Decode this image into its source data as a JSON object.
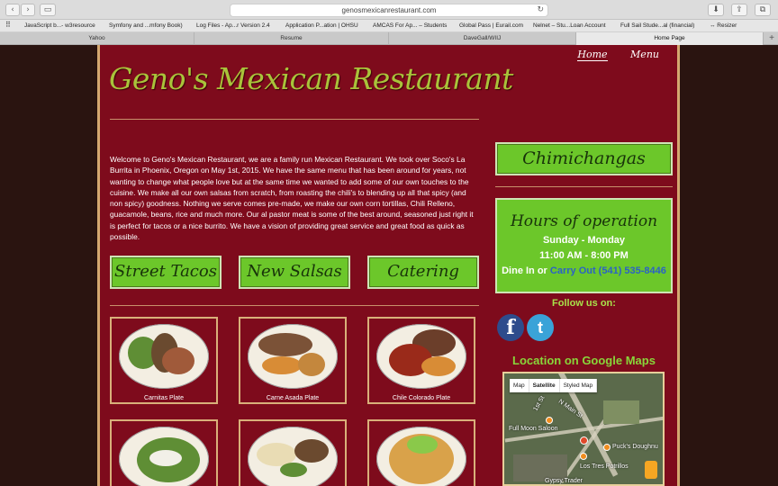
{
  "browser": {
    "back_glyph": "‹",
    "forward_glyph": "›",
    "sidebar_icon": "sidebar-icon",
    "url": "genosmexicanrestaurant.com",
    "reload_glyph": "↻",
    "download_glyph": "⬇",
    "share_glyph": "⇪",
    "tabs_glyph": "⧉",
    "bookmarks": [
      "JavaScript b...- w3resource",
      "Symfony and ...mfony Book)",
      "Log Files - Ap...r Version 2.4",
      "Application P...ation | OHSU",
      "AMCAS For Ap... – Students",
      "Global Pass | Eurail.com",
      "Nelnet – Stu...Loan Account",
      "Full Sail Stude...al (financial)",
      "↔ Resizer"
    ],
    "tabs": [
      "Yahoo",
      "Resume",
      "DaveGall/WIIJ",
      "Home Page"
    ],
    "new_tab_glyph": "+"
  },
  "site": {
    "nav": [
      "Home",
      "Menu"
    ],
    "title": "Geno's Mexican Restaurant",
    "intro": "Welcome to Geno's Mexican Restaurant, we are a family run Mexican Restaurant. We took over Soco's La Burrita in Phoenix, Oregon on May 1st, 2015. We have the same menu that has been around for years, not wanting to change what people love but at the same time we wanted to add some of our own touches to the cuisine. We make all our own salsas from scratch, from roasting the chili's to blending up all that spicy (and non spicy) goodness. Nothing we serve comes pre-made, we make our own corn tortillas, Chili Relleno, guacamole, beans, rice and much more. Our al pastor meat is some of the best around, seasoned just right it is perfect for tacos or a nice burrito. We have a vision of providing great service and great food as quick as possible.",
    "buttons": [
      "Street Tacos",
      "New Salsas",
      "Catering"
    ],
    "food": [
      {
        "caption": "Carnitas Plate"
      },
      {
        "caption": "Carne Asada Plate"
      },
      {
        "caption": "Chile Colorado Plate"
      },
      {
        "caption": ""
      },
      {
        "caption": ""
      },
      {
        "caption": ""
      }
    ],
    "chimichangas": "Chimichangas",
    "hours": {
      "title": "Hours of operation",
      "days": "Sunday - Monday",
      "time": "11:00 AM - 8:00 PM",
      "dine_in": "Dine In or",
      "carry_out": "Carry Out (541) 535-8446"
    },
    "follow": "Follow us on:",
    "social": {
      "facebook": "f",
      "twitter": "t"
    },
    "location_title": "Location on Google Maps",
    "map": {
      "controls": [
        "Map",
        "Satellite",
        "Styled Map"
      ],
      "labels": [
        "Full Moon Saloon",
        "Puck's Doughnu",
        "Los Tres Potrillos",
        "N Main St",
        "1st St",
        "Gypsy Trader"
      ]
    }
  },
  "colors": {
    "page_bg": "#7e0b1c",
    "accent_green": "#6cc72a",
    "title_green": "#a9c33a",
    "border_tan": "#d4a870"
  }
}
